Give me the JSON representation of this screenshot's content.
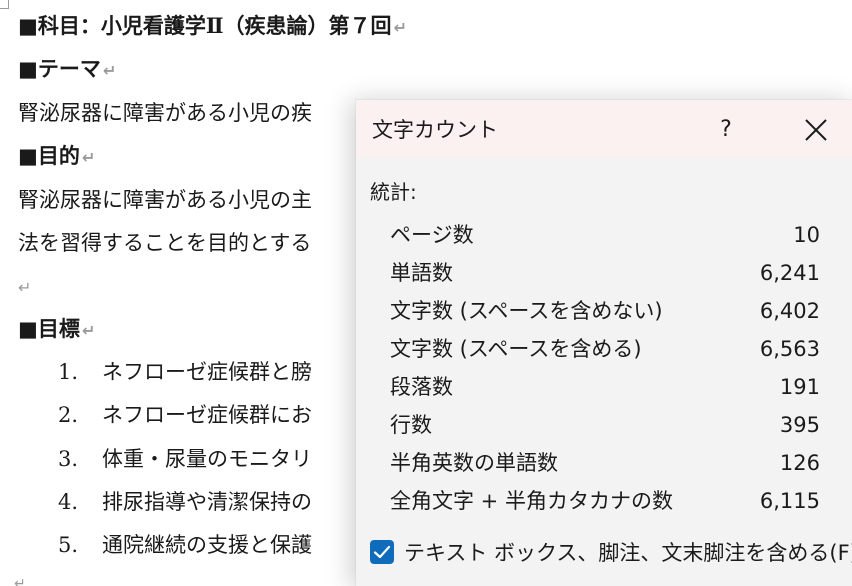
{
  "document": {
    "title_line": "■科目：小児看護学Ⅱ（疾患論）第７回",
    "theme_heading": "■テーマ",
    "theme_text": "腎泌尿器に障害がある小児の疾",
    "purpose_heading": "■目的",
    "purpose_text_1": "腎泌尿器に障害がある小児の主",
    "purpose_text_2": "法を習得することを目的とする",
    "goals_heading": "■目標",
    "goals": [
      {
        "num": "1.",
        "text": "ネフローゼ症候群と膀"
      },
      {
        "num": "2.",
        "text": "ネフローゼ症候群にお"
      },
      {
        "num": "3.",
        "text": "体重・尿量のモニタリ"
      },
      {
        "num": "4.",
        "text": "排尿指導や清潔保持の"
      },
      {
        "num": "5.",
        "text": "通院継続の支援と保護"
      }
    ],
    "paragraph_mark": "↵"
  },
  "dialog": {
    "title": "文字カウント",
    "help_label": "?",
    "statistics_label": "統計:",
    "stats": [
      {
        "label": "ページ数",
        "value": "10"
      },
      {
        "label": "単語数",
        "value": "6,241"
      },
      {
        "label": "文字数 (スペースを含めない)",
        "value": "6,402"
      },
      {
        "label": "文字数 (スペースを含める)",
        "value": "6,563"
      },
      {
        "label": "段落数",
        "value": "191"
      },
      {
        "label": "行数",
        "value": "395"
      },
      {
        "label": "半角英数の単語数",
        "value": "126"
      },
      {
        "label": "全角文字 + 半角カタカナの数",
        "value": "6,115"
      }
    ],
    "checkbox_label": "テキスト ボックス、脚注、文末脚注を含める(F)",
    "checkbox_checked": true,
    "accent_color": "#0f6cbd",
    "icons": {
      "close": "close-icon",
      "check": "checkmark-icon"
    }
  }
}
